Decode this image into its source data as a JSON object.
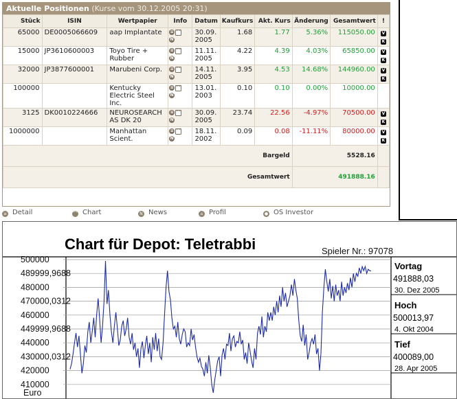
{
  "portfolio": {
    "title": "Aktuelle Positionen",
    "subtitle": "(Kurse vom 30.12.2005 20:31)",
    "columns": [
      "Stück",
      "ISIN",
      "Wertpapier",
      "Info",
      "Datum",
      "Kaufkurs",
      "Akt. Kurs",
      "Änderung",
      "Gesamtwert",
      "!"
    ],
    "rows": [
      {
        "qty": "65000",
        "isin": "DE0005066609",
        "name": "aap Implantate",
        "date": "30.09. 2005",
        "buy": "1.68",
        "cur": "1.77",
        "chg": "5.36%",
        "total": "115050.00",
        "trend": "up",
        "flags": 2
      },
      {
        "qty": "15000",
        "isin": "JP3610600003",
        "name": "Toyo Tire + Rubber",
        "date": "11.11. 2005",
        "buy": "4.22",
        "cur": "4.39",
        "chg": "4.03%",
        "total": "65850.00",
        "trend": "up",
        "flags": 2
      },
      {
        "qty": "32000",
        "isin": "JP3877600001",
        "name": "Marubeni Corp.",
        "date": "14.11. 2005",
        "buy": "3.95",
        "cur": "4.53",
        "chg": "14.68%",
        "total": "144960.00",
        "trend": "up",
        "flags": 2
      },
      {
        "qty": "100000",
        "isin": "",
        "name": "Kentucky Electric Steel Inc.",
        "date": "13.01. 2003",
        "buy": "0.10",
        "cur": "0.10",
        "chg": "0.00%",
        "total": "10000.00",
        "trend": "up",
        "flags": 0
      },
      {
        "qty": "3125",
        "isin": "DK0010224666",
        "name": "NEUROSEARCH AS DK 20",
        "date": "30.09. 2005",
        "buy": "23.74",
        "cur": "22.56",
        "chg": "-4.97%",
        "total": "70500.00",
        "trend": "down",
        "flags": 2
      },
      {
        "qty": "1000000",
        "isin": "",
        "name": "Manhattan Scient.",
        "date": "18.11. 2002",
        "buy": "0.09",
        "cur": "0.08",
        "chg": "-11.11%",
        "total": "80000.00",
        "trend": "down",
        "flags": 2
      }
    ],
    "cash_label": "Bargeld",
    "cash_value": "5528.16",
    "total_label": "Gesamtwert",
    "total_value": "491888.16",
    "colors": {
      "header": "#a5957d",
      "up": "#21a038",
      "down": "#d01d1d",
      "row_alt": "#f4f0e8"
    }
  },
  "legend": [
    {
      "icon": "detail-icon",
      "glyph": "≡",
      "label": "Detail"
    },
    {
      "icon": "chart-icon",
      "glyph": "⌒",
      "label": "Chart"
    },
    {
      "icon": "news-icon",
      "glyph": "N",
      "label": "News"
    },
    {
      "icon": "profile-icon",
      "glyph": "⌂",
      "label": "Profil"
    },
    {
      "icon": "os-investor-icon",
      "glyph": "●",
      "label": "OS Investor"
    }
  ],
  "chart_data": {
    "type": "line",
    "title": "Chart für Depot:  Teletrabbi",
    "player_label": "Spieler Nr.: 97078",
    "yunit": "Euro",
    "ylim": [
      400000,
      500000
    ],
    "yticks": [
      "500000",
      "489999,9688",
      "480000",
      "470000,0312",
      "460000",
      "449999,9688",
      "440000",
      "430000,0312",
      "420000",
      "410000"
    ],
    "ytick_values": [
      500000,
      489999.9688,
      480000,
      470000.0312,
      460000,
      449999.9688,
      440000,
      430000.0312,
      420000,
      410000
    ],
    "x_start": "28. Apr 2005",
    "x_end": "30. Dez 2005",
    "values": [
      421000,
      425000,
      432000,
      440000,
      447000,
      437000,
      445000,
      432000,
      418000,
      425000,
      438000,
      433000,
      448000,
      455000,
      440000,
      448000,
      458000,
      444000,
      460000,
      472000,
      458000,
      440000,
      452000,
      470000,
      499000,
      468000,
      478000,
      460000,
      448000,
      440000,
      452000,
      462000,
      451000,
      438000,
      442000,
      452000,
      456000,
      445000,
      450000,
      458000,
      444000,
      439000,
      447000,
      435000,
      440000,
      430000,
      436000,
      422000,
      436000,
      441000,
      429000,
      438000,
      445000,
      432000,
      440000,
      426000,
      444000,
      435000,
      447000,
      434000,
      443000,
      430000,
      428000,
      440000,
      460000,
      480000,
      492000,
      477000,
      471000,
      458000,
      450000,
      452000,
      444000,
      455000,
      443000,
      439000,
      446000,
      450000,
      448000,
      437000,
      440000,
      438000,
      450000,
      442000,
      446000,
      437000,
      430000,
      426000,
      429000,
      423000,
      421000,
      416000,
      426000,
      418000,
      431000,
      422000,
      410000,
      404000,
      413000,
      420000,
      427000,
      430000,
      416000,
      431000,
      436000,
      428000,
      439000,
      438000,
      447000,
      434000,
      443000,
      445000,
      437000,
      441000,
      440000,
      448000,
      439000,
      442000,
      428000,
      433000,
      425000,
      440000,
      434000,
      427000,
      422000,
      436000,
      428000,
      447000,
      452000,
      446000,
      459000,
      444000,
      452000,
      448000,
      462000,
      456000,
      462000,
      456000,
      466000,
      460000,
      470000,
      462000,
      474000,
      466000,
      480000,
      470000,
      476000,
      466000,
      470000,
      474000,
      482000,
      474000,
      486000,
      478000,
      472000,
      456000,
      445000,
      441000,
      453000,
      438000,
      446000,
      428000,
      433000,
      440000,
      443000,
      439000,
      446000,
      432000,
      436000,
      420000,
      432000,
      462000,
      480000,
      493000,
      484000,
      477000,
      486000,
      472000,
      481000,
      470000,
      482000,
      474000,
      478000,
      470000,
      484000,
      474000,
      480000,
      476000,
      483000,
      478000,
      487000,
      480000,
      490000,
      484000,
      490000,
      488000,
      494000,
      490000,
      495000,
      492000,
      495000,
      490000,
      493000,
      492000,
      491900
    ],
    "color": "#1c2aa8",
    "grid": true,
    "legend_position": "none"
  },
  "stats": [
    {
      "label": "Vortag",
      "value": "491888,03",
      "date": "30. Dez 2005"
    },
    {
      "label": "Hoch",
      "value": "500013,97",
      "date": "4. Okt 2004"
    },
    {
      "label": "Tief",
      "value": "400089,00",
      "date": "28. Apr 2005"
    }
  ]
}
